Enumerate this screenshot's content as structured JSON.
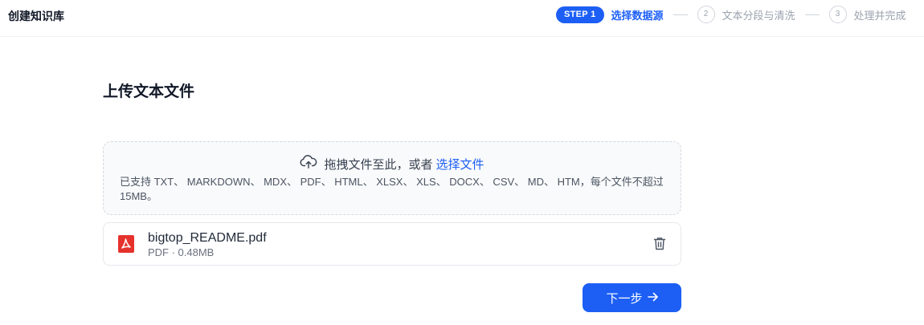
{
  "app": {
    "title": "创建知识库"
  },
  "steps": [
    {
      "badge": "STEP 1",
      "label": "选择数据源",
      "state": "active"
    },
    {
      "number": "2",
      "label": "文本分段与清洗",
      "state": "inactive"
    },
    {
      "number": "3",
      "label": "处理并完成",
      "state": "inactive"
    }
  ],
  "main": {
    "title": "上传文本文件",
    "dropzone": {
      "icon": "cloud-upload-icon",
      "prompt": "拖拽文件至此，或者",
      "link": "选择文件",
      "hint": "已支持 TXT、 MARKDOWN、 MDX、 PDF、 HTML、 XLSX、 XLS、 DOCX、 CSV、 MD、 HTM，每个文件不超过 15MB。"
    },
    "files": [
      {
        "icon": "pdf-file-icon",
        "name": "bigtop_README.pdf",
        "meta": "PDF · 0.48MB",
        "action_icon": "trash-icon"
      }
    ],
    "next_button": {
      "label": "下一步",
      "icon": "arrow-right-icon"
    }
  },
  "colors": {
    "accent": "#1d5ff5",
    "pdf": "#e5322d"
  }
}
